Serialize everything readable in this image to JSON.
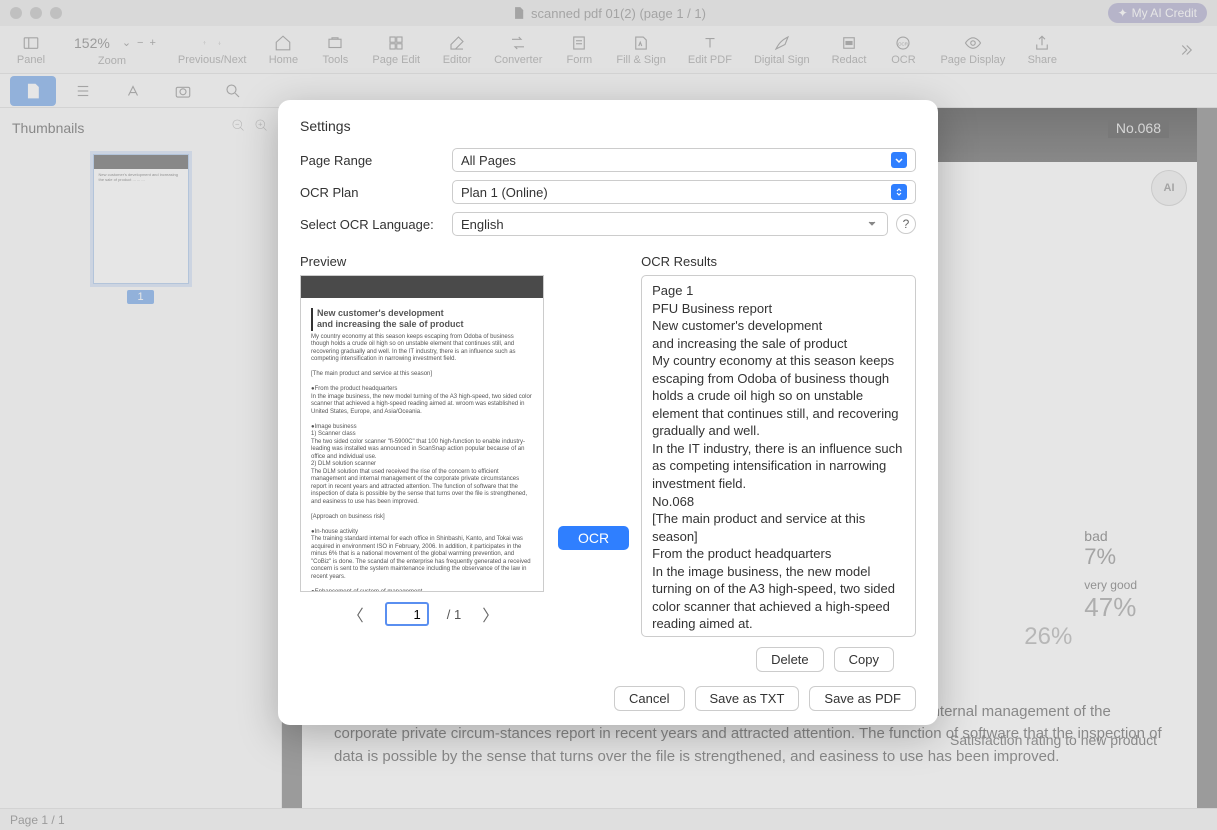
{
  "title": "scanned pdf 01(2) (page 1 / 1)",
  "credit_button": "My AI Credit",
  "toolbar": {
    "panel": "Panel",
    "zoom": "Zoom",
    "zoom_pct": "152%",
    "prev_next": "Previous/Next",
    "home": "Home",
    "tools": "Tools",
    "page_edit": "Page Edit",
    "editor": "Editor",
    "converter": "Converter",
    "form": "Form",
    "fill_sign": "Fill & Sign",
    "edit_pdf": "Edit PDF",
    "digital_sign": "Digital Sign",
    "redact": "Redact",
    "ocr": "OCR",
    "page_display": "Page Display",
    "share": "Share"
  },
  "sidebar": {
    "title": "Thumbnails",
    "page_num": "1"
  },
  "footer": {
    "page": "Page 1 / 1"
  },
  "doc": {
    "num": "No.068",
    "h1a": "New customer's development",
    "h1b": "and increasing the sale of product",
    "p1": "My country economy at this season keeps escaping from Odoba of business though holds a crude oil high so on unstable element that continues still, and recovering gradually and well.",
    "p2": "In the IT industry, there is an influence such as competing intensification in narrowing investment field.",
    "p3": "The DLM solution that used received the rise of the concern to efficient management and internal management of the corporate private circum-stances report in recent years and attracted attention. The function of software that the inspection of data is possible by the sense that turns over the file is strengthened, and easiness to use has been improved.",
    "rating": "Satisfaction rating to new product",
    "pie": {
      "bad": "bad",
      "bad_pct": "7%",
      "vg": "very good",
      "vg_pct": "47%",
      "g": "26%"
    }
  },
  "modal": {
    "title": "Settings",
    "page_range_label": "Page Range",
    "page_range_value": "All Pages",
    "ocr_plan_label": "OCR Plan",
    "ocr_plan_value": "Plan 1 (Online)",
    "lang_label": "Select OCR Language:",
    "lang_value": "English",
    "preview_label": "Preview",
    "ocr_button": "OCR",
    "results_label": "OCR Results",
    "results_text": "Page 1\nPFU Business report\nNew customer's development\nand increasing the sale of product\nMy country economy at this season keeps escaping from Odoba of business though holds a crude oil high so on unstable element that continues still, and recovering gradually and well.\nIn the IT industry, there is an influence such as competing intensification in narrowing investment field.\nNo.068\n[The main product and service at this season]\nFrom the product headquarters\nIn the image business, the new model turning on of the A3 high-speed, two sided color scanner that achieved a high-speed reading aimed at.\nwroom was established in United",
    "page_input": "1",
    "page_total": "/ 1",
    "delete": "Delete",
    "copy": "Copy",
    "cancel": "Cancel",
    "save_txt": "Save as TXT",
    "save_pdf": "Save as PDF"
  },
  "preview_thumb": {
    "title1": "New customer's development",
    "title2": "and increasing the sale of product",
    "body": "My country economy at this season keeps escaping from Odoba of business though holds a crude oil high so on unstable element that continues still, and recovering gradually and well. In the IT industry, there is an influence such as competing intensification in narrowing investment field.\n\n[The main product and service at this season]\n\n●From the product headquarters\nIn the image business, the new model turning of the A3 high-speed, two sided color scanner that achieved a high-speed reading aimed at. wroom was established in United States, Europe, and Asia/Oceania.\n\n●Image business\n1) Scanner class\nThe two sided color scanner \"fi-5900C\" that 100 high-function to enable industry-leading was installed was announced in ScanSnap action popular because of an office and individual use.\n2) DLM solution scanner\nThe DLM solution that used received the rise of the concern to efficient management and internal management of the corporate private circumstances report in recent years and attracted attention. The function of software that the inspection of data is possible by the sense that turns over the file is strengthened, and easiness to use has been improved.\n\n[Approach on business risk]\n\n●In-house activity\nThe training standard internal for each office in Shinbashi, Kanto, and Tokai was acquired in environment ISO in February, 2006. In addition, it participates in the minus 6% that is a national movement of the global warming prevention, and \"CoBiz\" is done. The scandal of the enterprise has frequently generated a received concern is sent to the system maintenance including the observance of the law in recent years.\n\n●Enhancement of system of management\nThe business that aimed at the decrease of a variety of business risks in an individual business talk was newly established. Moreover, the recognition of \"Privacy mark\" is received to manage customer and individual information adequately, and it strictly manages and it operates it by based on the protection of individual information policy & continued it is. Johoo Oceania in globalin addition, our technology, commodity power, and correspondence power were evaluating acquiri."
  }
}
